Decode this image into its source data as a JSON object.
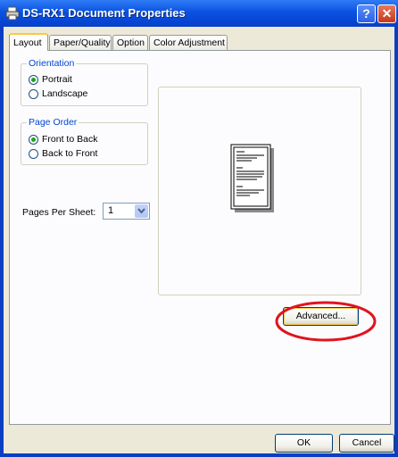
{
  "window": {
    "title": "DS-RX1 Document Properties",
    "help_label": "?",
    "close_label": "✕"
  },
  "tabs": [
    {
      "label": "Layout",
      "active": true
    },
    {
      "label": "Paper/Quality",
      "active": false
    },
    {
      "label": "Option",
      "active": false
    },
    {
      "label": "Color Adjustment",
      "active": false
    }
  ],
  "orientation": {
    "legend": "Orientation",
    "options": [
      {
        "label": "Portrait",
        "checked": true
      },
      {
        "label": "Landscape",
        "checked": false
      }
    ]
  },
  "page_order": {
    "legend": "Page Order",
    "options": [
      {
        "label": "Front to Back",
        "checked": true
      },
      {
        "label": "Back to Front",
        "checked": false
      }
    ]
  },
  "pages_per_sheet": {
    "label": "Pages Per Sheet:",
    "value": "1"
  },
  "buttons": {
    "advanced": "Advanced...",
    "ok": "OK",
    "cancel": "Cancel"
  },
  "colors": {
    "titlebar": "#0a52e0",
    "face": "#ece9d8",
    "group_legend": "#0046d5",
    "highlight_ellipse": "#e0141e"
  },
  "icons": {
    "title": "printer-icon",
    "preview": "document-page-icon",
    "dropdown": "chevron-down-icon"
  }
}
